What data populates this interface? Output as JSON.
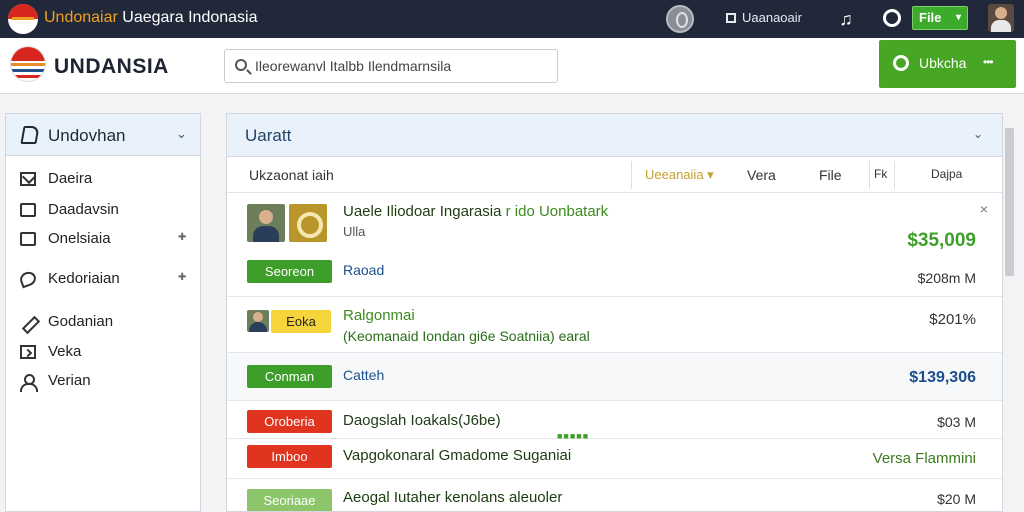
{
  "topbar": {
    "title_a": "Undonaiar",
    "title_b": "Uaegara Indonasia",
    "notif_label": "Uaanaoair",
    "file_button": "File",
    "file_caret": "▾",
    "music_glyph": "♫"
  },
  "header": {
    "brand": "UNDANSIA",
    "search_placeholder": "Ileorewanvl Italbb Ilendmarnsila",
    "action_button": "Ubkcha",
    "action_dots": "•••"
  },
  "sidebar": {
    "header_label": "Undovhan",
    "chevron": "⌄",
    "items": [
      {
        "label": "Daeira",
        "icon": "mail-icon"
      },
      {
        "label": "Daadavsin",
        "icon": "checkbox-icon"
      },
      {
        "label": "Onelsiaia",
        "icon": "checkbox-icon",
        "pin": "✚"
      },
      {
        "label": "Kedoriaian",
        "icon": "loop-icon",
        "pin": "✚"
      },
      {
        "label": "Godanian",
        "icon": "pen-icon"
      },
      {
        "label": "Veka",
        "icon": "tv-icon"
      },
      {
        "label": "Verian",
        "icon": "user-icon"
      }
    ]
  },
  "main": {
    "header_label": "Uaratt",
    "chevron": "⌄",
    "columns": {
      "name": "Ukzaonat iaih",
      "sort": "Ueeanaiia ▾",
      "vera": "Vera",
      "file": "File",
      "fa": "Fk",
      "price": "Dajpa"
    },
    "rows": [
      {
        "title_a": "Uaele Iliodoar  Ingarasia ",
        "title_b": "r ido Uonbatark",
        "sub": "Ulla",
        "price": "$35,009",
        "close": "×",
        "badge": "Seoreon",
        "link": "Raoad",
        "price2": "$208m M"
      },
      {
        "badge": "Eoka",
        "title": "Ralgonmai",
        "sub": "(Keomanaid Iondan gi6e Soatniia) earal",
        "price": "$201%"
      },
      {
        "badge": "Conman",
        "link": "Catteh",
        "price": "$139,306"
      },
      {
        "badge": "Oroberia",
        "title": "Daogslah Ioakals(J6be)",
        "dots": "■■■■■",
        "price": "$03 M"
      },
      {
        "badge": "Imboo",
        "title": "Vapgokonaral Gmadome Suganiai",
        "price": "Versa Flammini"
      },
      {
        "badge": "Seoriaae",
        "title": "Aeogal Iutaher kenolans aleuoler",
        "price": "$20 M"
      }
    ]
  },
  "colors": {
    "topbar": "#20283a",
    "accent_green": "#47a624",
    "badge_red": "#e0341e",
    "link_blue": "#1c4f8c"
  }
}
